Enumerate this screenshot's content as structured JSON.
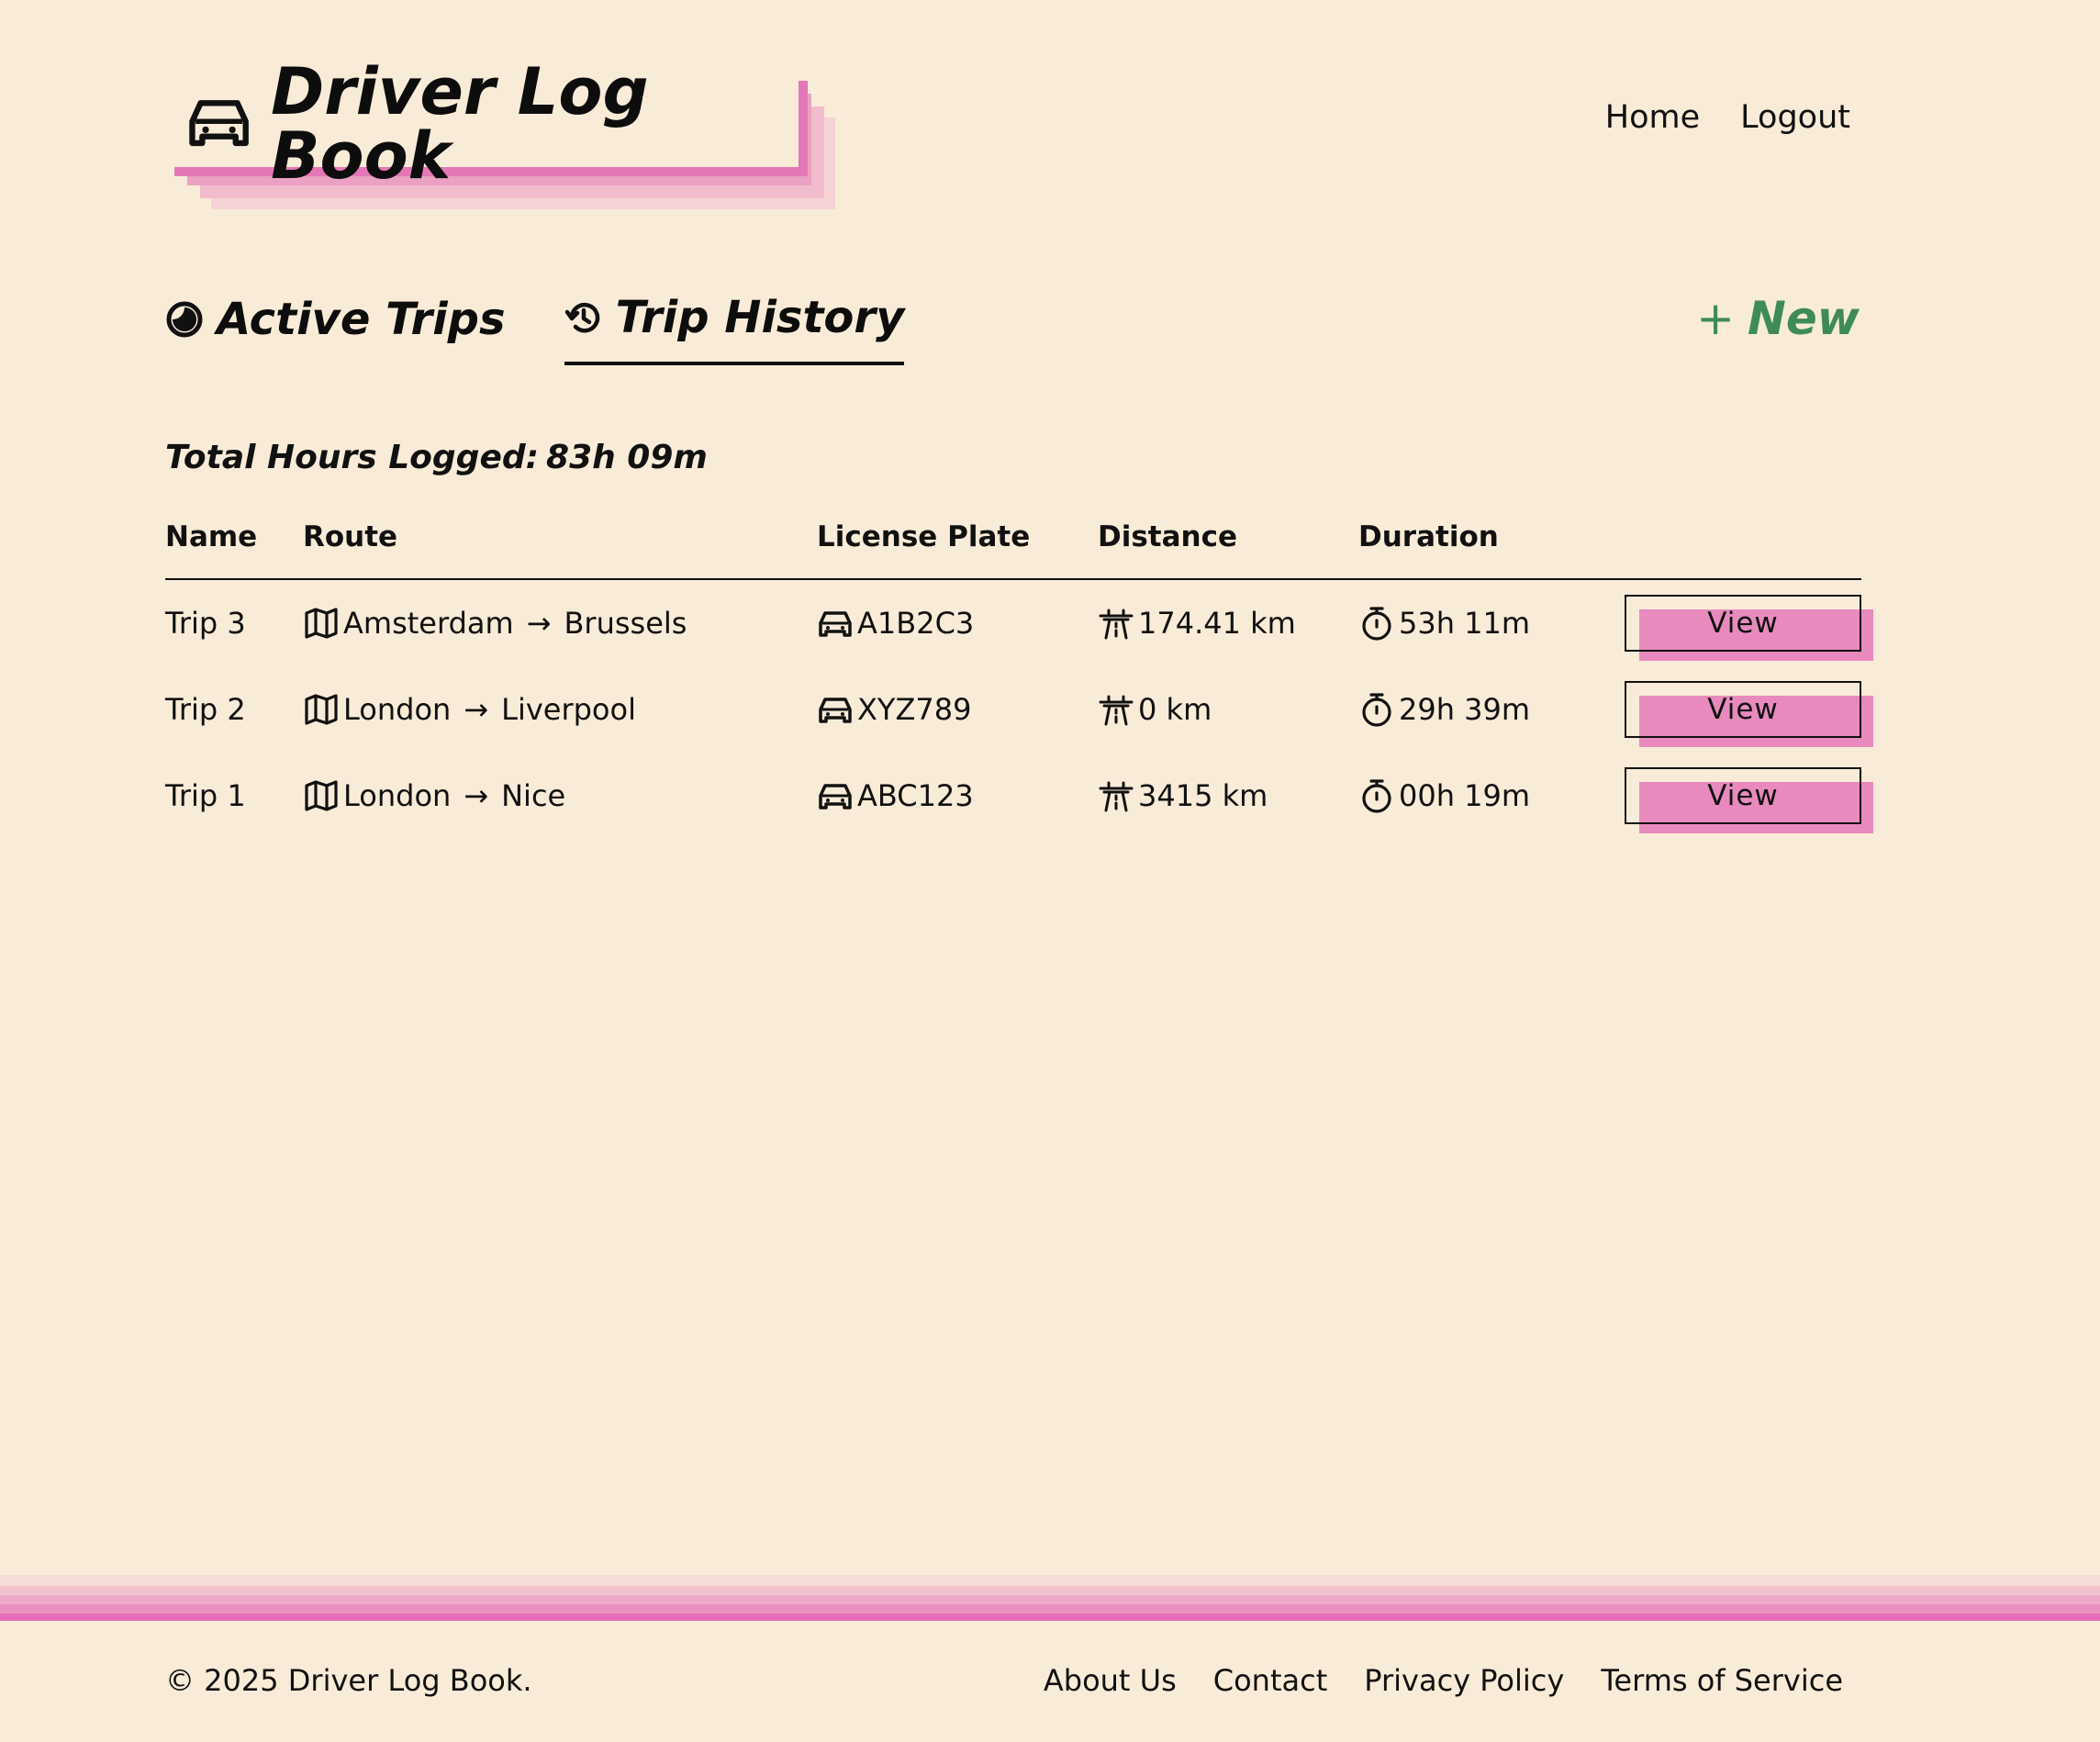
{
  "app": {
    "title": "Driver Log Book"
  },
  "nav": {
    "links": [
      "Home",
      "Logout"
    ]
  },
  "tabs": [
    {
      "label": "Active Trips",
      "icon": "half-circle-icon",
      "active": false
    },
    {
      "label": "Trip History",
      "icon": "history-icon",
      "active": true
    }
  ],
  "new_button": {
    "plus": "+",
    "label": "New"
  },
  "summary": {
    "label": "Total Hours Logged:",
    "value": "83h 09m"
  },
  "table": {
    "columns": [
      "Name",
      "Route",
      "License Plate",
      "Distance",
      "Duration"
    ],
    "rows": [
      {
        "name": "Trip 3",
        "from": "Amsterdam",
        "to": "Brussels",
        "plate": "A1B2C3",
        "distance": "174.41 km",
        "duration": "53h 11m",
        "action": "View"
      },
      {
        "name": "Trip 2",
        "from": "London",
        "to": "Liverpool",
        "plate": "XYZ789",
        "distance": "0 km",
        "duration": "29h 39m",
        "action": "View"
      },
      {
        "name": "Trip 1",
        "from": "London",
        "to": "Nice",
        "plate": "ABC123",
        "distance": "3415 km",
        "duration": "00h 19m",
        "action": "View"
      }
    ],
    "arrow": "→"
  },
  "footer": {
    "copyright": "© 2025 Driver Log Book.",
    "links": [
      "About Us",
      "Contact",
      "Privacy Policy",
      "Terms of Service"
    ]
  },
  "colors": {
    "background": "#f8ebd8",
    "accent_pink": "#e477b6",
    "new_green": "#3f8a59"
  }
}
